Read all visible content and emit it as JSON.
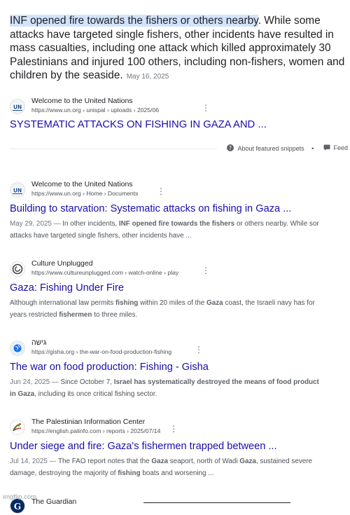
{
  "featured": {
    "highlight": "INF opened fire towards the fishers or others nearby",
    "text": ". While some attacks have targeted single fishers, other incidents have resulted in mass casualties, including one attack which killed approximately 30 Palestinians and injured 100 others, including non-fishers, women and children by the seaside.",
    "date": "May 16, 2025",
    "source": {
      "name": "Welcome to the United Nations",
      "url": "https://www.un.org › unispal › uploads › 2025/06",
      "icon": "un-logo-icon"
    },
    "title": "SYSTEMATIC ATTACKS ON FISHING IN GAZA AND ..."
  },
  "feedback_bar": {
    "about_label": "About featured snippets",
    "separator": "•",
    "feedback_label": "Feed"
  },
  "results": [
    {
      "name": "Welcome to the United Nations",
      "url": "https://www.un.org › Home › Documents",
      "icon": "un-logo-icon",
      "title": "Building to starvation: Systematic attacks on fishing in Gaza ...",
      "date": "May 29, 2025",
      "desc_pre": "In other incidents, ",
      "desc_bold": "INF opened fire towards the fishers",
      "desc_post": " or others nearby. While sor",
      "desc_line2": "attacks have targeted single fishers, other incidents have ..."
    },
    {
      "name": "Culture Unplugged",
      "url": "https://www.cultureunplugged.com › watch-online › play",
      "icon": "spiral-icon",
      "title": "Gaza: Fishing Under Fire",
      "desc_parts": [
        "Although international law permits ",
        "fishing",
        " within 20 miles of the ",
        "Gaza",
        " coast, the Israeli navy has for"
      ],
      "desc_line2_parts": [
        "years restricted ",
        "fishermen",
        " to three miles."
      ]
    },
    {
      "name": "גישה",
      "url": "https://gisha.org › the-war-on-food-production-fishing",
      "icon": "globe-icon",
      "title": "The war on food production: Fishing - Gisha",
      "date": "Jun 24, 2025",
      "desc_pre": "Since October 7, ",
      "desc_bold": "Israel has systematically destroyed the means of food product",
      "desc_line2_parts": [
        "in Gaza",
        ", including its once critical fishing sector."
      ]
    },
    {
      "name": "The Palestinian Information Center",
      "url": "https://english.palinfo.com › reports › 2025/07/14",
      "icon": "palinfo-logo-icon",
      "title": "Under siege and fire: Gaza's fishermen trapped between ...",
      "date": "Jul 14, 2025",
      "desc_parts": [
        "The FAO report notes that the ",
        "Gaza",
        " seaport, north of Wadi ",
        "Gaza",
        ", sustained severe"
      ],
      "desc_line2_parts": [
        "damage, destroying the majority of ",
        "fishing",
        " boats and worsening ..."
      ]
    },
    {
      "name": "The Guardian",
      "icon": "guardian-logo-icon"
    }
  ],
  "watermark": "imgflip.com",
  "date_sep": " — "
}
